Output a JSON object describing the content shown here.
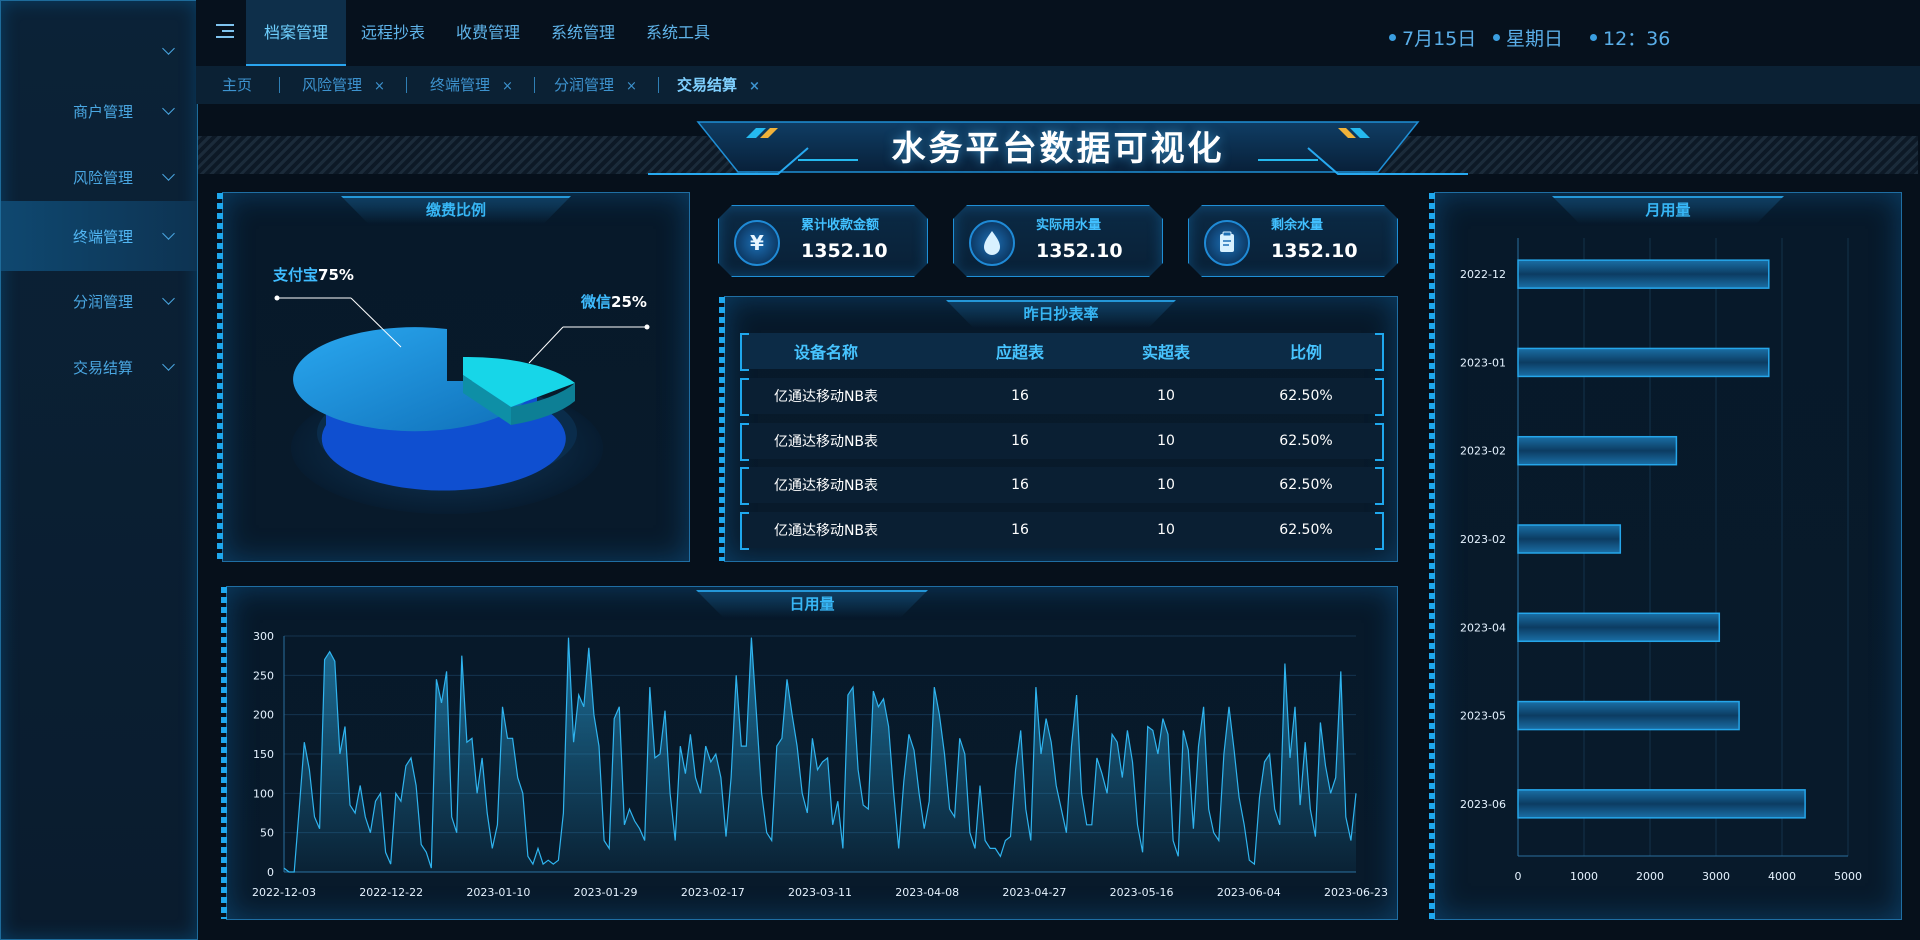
{
  "sidebar": {
    "items": [
      {
        "label": "",
        "active": false
      },
      {
        "label": "商户管理",
        "active": false
      },
      {
        "label": "风险管理",
        "active": false
      },
      {
        "label": "终端管理",
        "active": true
      },
      {
        "label": "分润管理",
        "active": false
      },
      {
        "label": "交易结算",
        "active": false
      }
    ]
  },
  "topnav": {
    "tabs": [
      "档案管理",
      "远程抄表",
      "收费管理",
      "系统管理",
      "系统工具"
    ],
    "active_tab": "档案管理",
    "date": "7月15日",
    "weekday": "星期日",
    "time": "12：36"
  },
  "breadcrumbs": {
    "home": "主页",
    "tabs": [
      {
        "label": "风险管理",
        "closable": true
      },
      {
        "label": "终端管理",
        "closable": true
      },
      {
        "label": "分润管理",
        "closable": true
      },
      {
        "label": "交易结算",
        "closable": true,
        "active": true
      }
    ],
    "close_glyph": "×"
  },
  "page_title": "水务平台数据可视化",
  "pie_panel": {
    "title": "缴费比例",
    "slices": [
      {
        "name": "支付宝",
        "percent": "75%",
        "value": 75,
        "color": "#1f8fdc"
      },
      {
        "name": "微信",
        "percent": "25%",
        "value": 25,
        "color": "#18cfe0"
      }
    ]
  },
  "kpis": [
    {
      "label": "累计收款金额",
      "value": "1352.10",
      "icon": "yen-icon",
      "glyph": "¥"
    },
    {
      "label": "实际用水量",
      "value": "1352.10",
      "icon": "water-drop-icon",
      "glyph": ""
    },
    {
      "label": "剩余水量",
      "value": "1352.10",
      "icon": "clipboard-icon",
      "glyph": ""
    }
  ],
  "table_panel": {
    "title": "昨日抄表率",
    "columns": [
      "设备名称",
      "应超表",
      "实超表",
      "比例"
    ],
    "rows": [
      [
        "亿通达移动NB表",
        "16",
        "10",
        "62.50%"
      ],
      [
        "亿通达移动NB表",
        "16",
        "10",
        "62.50%"
      ],
      [
        "亿通达移动NB表",
        "16",
        "10",
        "62.50%"
      ],
      [
        "亿通达移动NB表",
        "16",
        "10",
        "62.50%"
      ]
    ]
  },
  "daily_panel": {
    "title": "日用量"
  },
  "monthly_panel": {
    "title": "月用量"
  },
  "chart_data": [
    {
      "type": "pie",
      "title": "缴费比例",
      "labels": [
        "支付宝",
        "微信"
      ],
      "values": [
        75,
        25
      ]
    },
    {
      "type": "area",
      "title": "日用量",
      "ylim": [
        0,
        300
      ],
      "y_ticks": [
        0,
        50,
        100,
        150,
        200,
        250,
        300
      ],
      "x_ticks": [
        "2022-12-03",
        "2022-12-22",
        "2023-01-10",
        "2023-01-29",
        "2023-02-17",
        "2023-03-11",
        "2023-04-08",
        "2023-04-27",
        "2023-05-16",
        "2023-06-04",
        "2023-06-23"
      ],
      "values": [
        5,
        0,
        0,
        80,
        165,
        130,
        70,
        55,
        270,
        280,
        268,
        150,
        185,
        85,
        75,
        110,
        70,
        50,
        90,
        100,
        25,
        10,
        100,
        90,
        135,
        145,
        110,
        35,
        25,
        5,
        245,
        215,
        255,
        70,
        50,
        275,
        165,
        170,
        100,
        145,
        75,
        30,
        60,
        210,
        170,
        170,
        120,
        100,
        20,
        10,
        30,
        10,
        15,
        10,
        15,
        75,
        298,
        165,
        225,
        210,
        285,
        200,
        160,
        40,
        30,
        195,
        210,
        60,
        80,
        65,
        55,
        40,
        235,
        145,
        150,
        205,
        100,
        40,
        160,
        125,
        175,
        120,
        100,
        160,
        140,
        150,
        120,
        45,
        120,
        250,
        160,
        160,
        298,
        200,
        100,
        50,
        40,
        160,
        170,
        245,
        200,
        160,
        100,
        75,
        170,
        130,
        140,
        145,
        60,
        90,
        30,
        225,
        235,
        130,
        85,
        80,
        230,
        210,
        220,
        185,
        100,
        30,
        115,
        175,
        155,
        100,
        55,
        90,
        235,
        200,
        150,
        80,
        70,
        170,
        150,
        50,
        30,
        110,
        40,
        30,
        30,
        20,
        40,
        45,
        130,
        180,
        80,
        40,
        235,
        150,
        195,
        165,
        110,
        80,
        50,
        160,
        225,
        100,
        60,
        60,
        145,
        125,
        100,
        175,
        165,
        120,
        180,
        140,
        60,
        25,
        185,
        180,
        150,
        195,
        175,
        40,
        20,
        180,
        155,
        55,
        160,
        210,
        80,
        50,
        40,
        150,
        210,
        155,
        95,
        60,
        15,
        10,
        95,
        140,
        150,
        80,
        60,
        265,
        145,
        210,
        85,
        165,
        80,
        45,
        190,
        135,
        100,
        120,
        255,
        70,
        40,
        100
      ],
      "color": "#2fb4ef"
    },
    {
      "type": "bar",
      "title": "月用量",
      "orientation": "horizontal",
      "categories": [
        "2022-12",
        "2023-01",
        "2023-02",
        "2023-02",
        "2023-04",
        "2023-05",
        "2023-06"
      ],
      "values": [
        3800,
        3800,
        2400,
        1550,
        3050,
        3350,
        4350
      ],
      "xlim": [
        0,
        5000
      ],
      "x_ticks": [
        0,
        1000,
        2000,
        3000,
        4000,
        5000
      ]
    }
  ]
}
